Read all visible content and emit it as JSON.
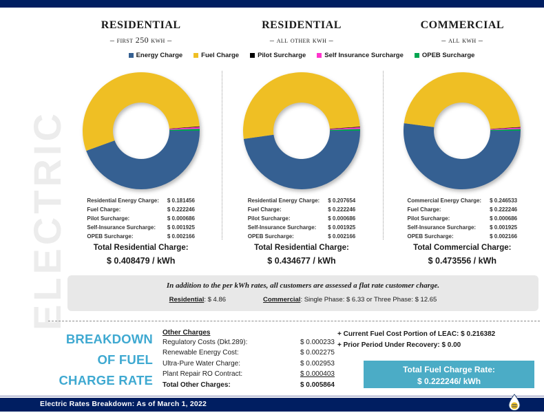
{
  "colors": {
    "navy": "#001E61",
    "energy_charge": "#356092",
    "fuel_charge": "#EFBF24",
    "pilot_surcharge": "#000000",
    "self_insurance_surcharge": "#FF33CC",
    "opeb_surcharge": "#00A550",
    "teal": "#4BACC6",
    "breakdown_heading": "#3FA9D1",
    "note_box_bg": "#E8E8E8",
    "watermark": "#ECECEC"
  },
  "watermark": {
    "text": "ELECTRIC"
  },
  "legend": {
    "items": [
      {
        "label": "Energy Charge",
        "color": "#356092",
        "icon": "square-swatch-icon"
      },
      {
        "label": "Fuel Charge",
        "color": "#EFBF24",
        "icon": "square-swatch-icon"
      },
      {
        "label": "Pilot Surcharge",
        "color": "#000000",
        "icon": "square-swatch-icon"
      },
      {
        "label": "Self Insurance Surcharge",
        "color": "#FF33CC",
        "icon": "square-swatch-icon"
      },
      {
        "label": "OPEB Surcharge",
        "color": "#00A550",
        "icon": "square-swatch-icon"
      }
    ]
  },
  "columns": [
    {
      "title": "Residential",
      "subtitle": "– First 250 kWh –",
      "rows": [
        {
          "label": "Residential Energy Charge:",
          "value": "$ 0.181456"
        },
        {
          "label": "Fuel Charge:",
          "value": "$ 0.222246"
        },
        {
          "label": "Pilot Surcharge:",
          "value": "$ 0.000686"
        },
        {
          "label": "Self-Insurance Surcharge:",
          "value": "$ 0.001925"
        },
        {
          "label": "OPEB Surcharge:",
          "value": "$ 0.002166"
        }
      ],
      "total_label": "Total Residential Charge:",
      "total_value": "$ 0.408479 / kWh"
    },
    {
      "title": "Residential",
      "subtitle": "– All other kWh –",
      "rows": [
        {
          "label": "Residential Energy Charge:",
          "value": "$ 0.207654"
        },
        {
          "label": "Fuel Charge:",
          "value": "$ 0.222246"
        },
        {
          "label": "Pilot Surcharge:",
          "value": "$ 0.000686"
        },
        {
          "label": "Self-Insurance Surcharge:",
          "value": "$ 0.001925"
        },
        {
          "label": "OPEB Surcharge:",
          "value": "$ 0.002166"
        }
      ],
      "total_label": "Total Residential Charge:",
      "total_value": "$ 0.434677 / kWh"
    },
    {
      "title": "Commercial",
      "subtitle": "– All kWh –",
      "rows": [
        {
          "label": "Commercial Energy Charge:",
          "value": "$ 0.246533"
        },
        {
          "label": "Fuel Charge:",
          "value": "$ 0.222246"
        },
        {
          "label": "Pilot Surcharge:",
          "value": "$ 0.000686"
        },
        {
          "label": "Self-Insurance Surcharge:",
          "value": "$ 0.001925"
        },
        {
          "label": "OPEB Surcharge:",
          "value": "$ 0.002166"
        }
      ],
      "total_label": "Total Commercial Charge:",
      "total_value": "$ 0.473556 / kWh"
    }
  ],
  "note": {
    "line1": "In addition to the per kWh rates, all customers are assessed a flat rate customer charge.",
    "residential_label": "Residential",
    "residential_value": ": $ 4.86",
    "commercial_label": "Commercial",
    "commercial_value": ": Single Phase: $ 6.33   or Three Phase: $ 12.65"
  },
  "breakdown": {
    "heading_line1": "BREAKDOWN",
    "heading_line2": "OF FUEL",
    "heading_line3": "CHARGE RATE",
    "other_charges_title": "Other Charges",
    "other_charges": [
      {
        "label": "Regulatory Costs (Dkt.289):",
        "value": "$ 0.000233"
      },
      {
        "label": "Renewable Energy Cost:",
        "value": "$ 0.002275"
      },
      {
        "label": "Ultra-Pure Water Charge:",
        "value": "$ 0.002953"
      },
      {
        "label": "Plant Repair RO Contract:",
        "value": "$ 0.000403"
      }
    ],
    "total_other_label": "Total Other Charges:",
    "total_other_value": "$ 0.005864",
    "leac_line": "+ Current Fuel Cost Portion of LEAC: $ 0.216382",
    "prior_period_line": "+ Prior Period Under Recovery: $ 0.00",
    "total_fuel_label": "Total Fuel Charge Rate:",
    "total_fuel_value": "$ 0.222246/ kWh"
  },
  "footer": {
    "text": "Electric Rates Breakdown: As of March 1, 2022",
    "logo_icon": "water-drop-logo-icon"
  },
  "chart_data": [
    {
      "type": "pie",
      "title": "Residential – First 250 kWh –",
      "labels": [
        "Energy Charge",
        "Fuel Charge",
        "Pilot Surcharge",
        "Self Insurance Surcharge",
        "OPEB Surcharge"
      ],
      "values": [
        0.181456,
        0.222246,
        0.000686,
        0.001925,
        0.002166
      ],
      "colors": [
        "#356092",
        "#EFBF24",
        "#000000",
        "#FF33CC",
        "#00A550"
      ],
      "total": 0.408479,
      "donut": true,
      "legend_position": "top"
    },
    {
      "type": "pie",
      "title": "Residential – All other kWh –",
      "labels": [
        "Energy Charge",
        "Fuel Charge",
        "Pilot Surcharge",
        "Self Insurance Surcharge",
        "OPEB Surcharge"
      ],
      "values": [
        0.207654,
        0.222246,
        0.000686,
        0.001925,
        0.002166
      ],
      "colors": [
        "#356092",
        "#EFBF24",
        "#000000",
        "#FF33CC",
        "#00A550"
      ],
      "total": 0.434677,
      "donut": true,
      "legend_position": "top"
    },
    {
      "type": "pie",
      "title": "Commercial – All kWh –",
      "labels": [
        "Energy Charge",
        "Fuel Charge",
        "Pilot Surcharge",
        "Self Insurance Surcharge",
        "OPEB Surcharge"
      ],
      "values": [
        0.246533,
        0.222246,
        0.000686,
        0.001925,
        0.002166
      ],
      "colors": [
        "#356092",
        "#EFBF24",
        "#000000",
        "#FF33CC",
        "#00A550"
      ],
      "total": 0.473556,
      "donut": true,
      "legend_position": "top"
    }
  ]
}
